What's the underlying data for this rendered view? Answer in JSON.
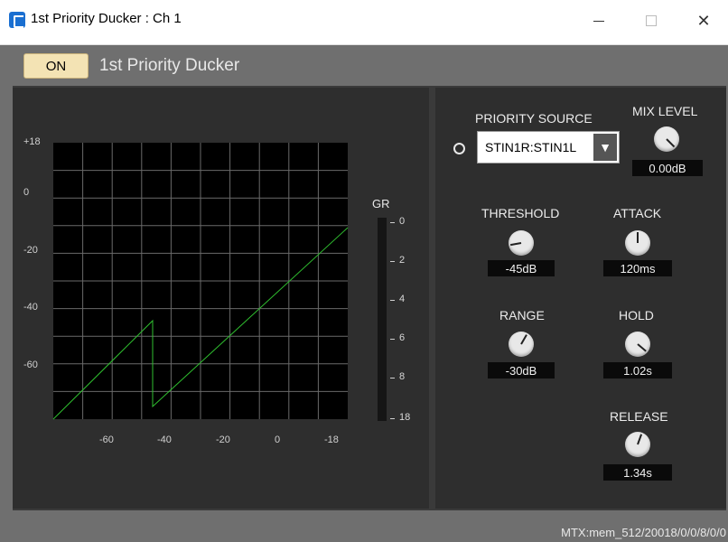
{
  "window": {
    "title": "1st Priority Ducker : Ch 1",
    "controls": {
      "minimize": "—",
      "maximize": "☐",
      "close": "✕"
    }
  },
  "header": {
    "on_label": "ON",
    "module_title": "1st Priority Ducker"
  },
  "graph": {
    "y_ticks": [
      "+18",
      "0",
      "-20",
      "-40",
      "-60"
    ],
    "x_ticks": [
      "-60",
      "-40",
      "-20",
      "0",
      "-18"
    ],
    "line_color": "#2fbf2f"
  },
  "gr_meter": {
    "label": "GR",
    "ticks": [
      "0",
      "2",
      "4",
      "6",
      "8",
      "18"
    ]
  },
  "controls": {
    "priority_source": {
      "label": "PRIORITY SOURCE",
      "value": "STIN1R:STIN1L",
      "arrow": "▼"
    },
    "mix_level": {
      "label": "MIX LEVEL",
      "value": "0.00dB"
    },
    "threshold": {
      "label": "THRESHOLD",
      "value": "-45dB"
    },
    "attack": {
      "label": "ATTACK",
      "value": "120ms"
    },
    "range": {
      "label": "RANGE",
      "value": "-30dB"
    },
    "hold": {
      "label": "HOLD",
      "value": "1.02s"
    },
    "release": {
      "label": "RELEASE",
      "value": "1.34s"
    }
  },
  "footer": {
    "address": "MTX:mem_512/20018/0/0/8/0/0"
  }
}
